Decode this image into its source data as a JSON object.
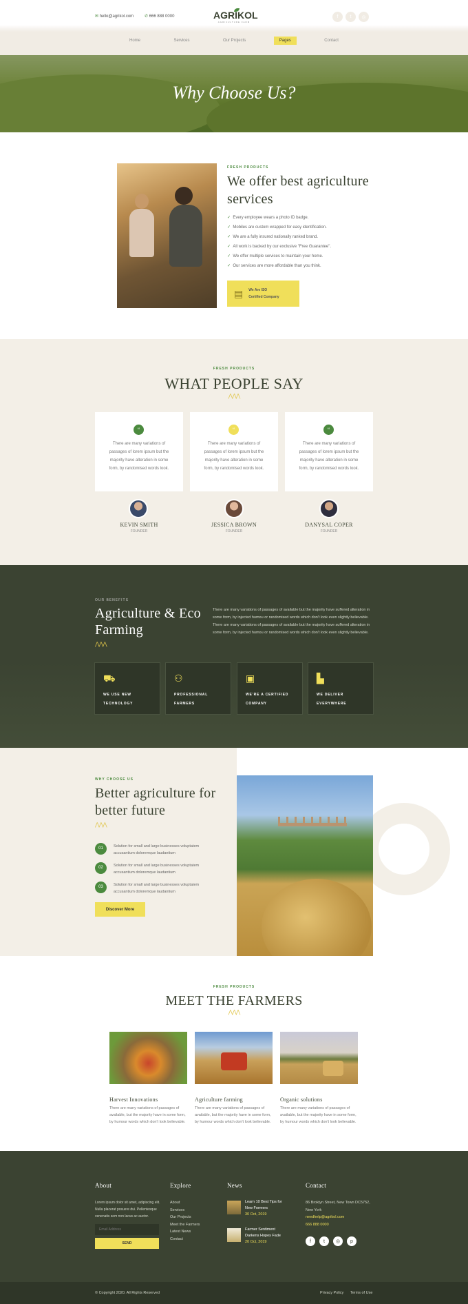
{
  "header": {
    "email": "hello@agrikol.com",
    "phone": "666 888 0000",
    "logo": "AGRIKOL",
    "logo_sub": "AGRICULTURE FARM",
    "nav": [
      "Home",
      "Services",
      "Our Projects",
      "Pages",
      "Contact"
    ],
    "active": "Pages",
    "social": [
      "facebook-icon",
      "twitter-icon",
      "instagram-icon"
    ]
  },
  "hero": {
    "title": "Why Choose Us?"
  },
  "offer": {
    "tag": "FRESH PRODUCTS",
    "title_line1": "We offer best agriculture",
    "title_line2": "services",
    "items": [
      "Every employee wears a photo ID badge.",
      "Mobiles are custom wrapped for easy identification.",
      "We are a fully insured nationally ranked brand.",
      "All work is backed by our exclusive \"Free Guarantee\".",
      "We offer multiple services to maintain your home.",
      "Our services are more affordable than you think."
    ],
    "badge_line1": "We Are ISO",
    "badge_line2": "Certified Company"
  },
  "testimonials": {
    "tag": "FRESH PRODUCTS",
    "title": "WHAT PEOPLE SAY",
    "items": [
      {
        "text": "There are many variations of passages of lorem ipsum but the majority have alteration in some form, by randomised words look.",
        "name": "KEVIN SMITH",
        "role": "FOUNDER",
        "quote_color": "#4b8a3e"
      },
      {
        "text": "There are many variations of passages of lorem ipsum but the majority have alteration in some form, by randomised words look.",
        "name": "JESSICA BROWN",
        "role": "FOUNDER",
        "quote_color": "#f0df5a"
      },
      {
        "text": "There are many variations of passages of lorem ipsum but the majority have alteration in some form, by randomised words look.",
        "name": "DANYSAL COPER",
        "role": "FOUNDER",
        "quote_color": "#4b8a3e"
      }
    ]
  },
  "benefits": {
    "tag": "OUR BENEFITS",
    "title_line1": "Agriculture & Eco",
    "title_line2": "Farming",
    "text": "There are many variations of passages of available but the majority have suffered alteration in some form, by injected humou or randomised words which don't look even slightly believable. There are many variations of passages of available but the majority have suffered alteration in some form, by injected humou or randomised words which don't look even slightly believable.",
    "cards": [
      {
        "icon": "tractor-icon",
        "line1": "WE USE NEW",
        "line2": "TECHNOLOGY"
      },
      {
        "icon": "farmers-icon",
        "line1": "PROFESSIONAL",
        "line2": "FARMERS"
      },
      {
        "icon": "certificate-icon",
        "line1": "WE'RE A CERTIFIED",
        "line2": "COMPANY"
      },
      {
        "icon": "delivery-icon",
        "line1": "WE DELIVER",
        "line2": "EVERYWHERE"
      }
    ]
  },
  "why": {
    "tag": "WHY CHOOSE US",
    "title_line1": "Better agriculture for",
    "title_line2": "better future",
    "steps": [
      {
        "num": "01",
        "text": "Solution for small and large businesses voluptatem accusantium doloremque laudantium"
      },
      {
        "num": "02",
        "text": "Solution for small and large businesses voluptatem accusantium doloremque laudantium"
      },
      {
        "num": "03",
        "text": "Solution for small and large businesses voluptatem accusantium doloremque laudantium"
      }
    ],
    "button": "Discover More"
  },
  "farmers": {
    "tag": "FRESH PRODUCTS",
    "title": "MEET THE FARMERS",
    "items": [
      {
        "title": "Harvest Innovations",
        "text": "There are many variations of passages of available, but the majority have in some form, by humour words which don't look believable."
      },
      {
        "title": "Agriculture farming",
        "text": "There are many variations of passages of available, but the majority have in some form, by humour words which don't look believable."
      },
      {
        "title": "Organic solutions",
        "text": "There are many variations of passages of available, but the majority have in some form, by humour words which don't look believable."
      }
    ]
  },
  "footer": {
    "about_title": "About",
    "about_text": "Lorem ipsum dolor sit amet, adipiscing elit. Nulla placerat posuere dui. Pellentesque venenatis sem non lacus ac auctor.",
    "email_placeholder": "Email Address",
    "send": "SEND",
    "explore_title": "Explore",
    "explore": [
      "About",
      "Services",
      "Our Projects",
      "Meet the Farmers",
      "Latest News",
      "Contact"
    ],
    "news_title": "News",
    "news": [
      {
        "title1": "Learn 10 Best Tips for",
        "title2": "New Formers",
        "date": "30 Oct, 2019"
      },
      {
        "title1": "Farmer Sentiment",
        "title2": "Darkens Hopes Fade",
        "date": "20 Oct, 2019"
      }
    ],
    "contact_title": "Contact",
    "address1": "86 Broklyn Street, New Town DC5752,",
    "address2": "New York",
    "email": "needhelp@agrikol.com",
    "phone": "666 888 0000",
    "social": [
      "facebook-icon",
      "twitter-icon",
      "instagram-icon",
      "pinterest-icon"
    ],
    "copyright": "© Copyright 2020. All Rights Reserved",
    "links": [
      "Privacy Policy",
      "Terms of Use"
    ]
  }
}
